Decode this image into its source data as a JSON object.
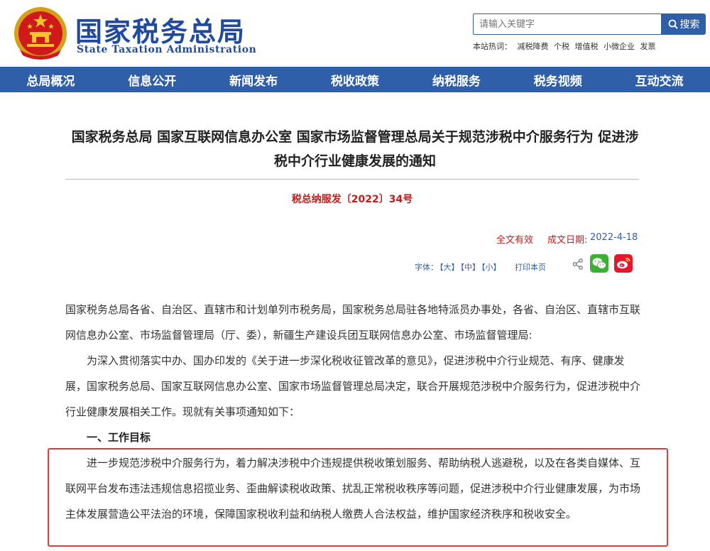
{
  "header": {
    "title_cn": "国家税务总局",
    "title_en": "State Taxation Administration",
    "search_placeholder": "请输入关键字",
    "search_button": "搜索",
    "hotwords_label": "本站热词：",
    "hotwords": [
      "减税降费",
      "个税",
      "增值税",
      "小微企业",
      "发票"
    ]
  },
  "nav": {
    "items": [
      "总局概况",
      "信息公开",
      "新闻发布",
      "税收政策",
      "纳税服务",
      "税务视频",
      "互动交流"
    ]
  },
  "article": {
    "title": "国家税务总局 国家互联网信息办公室 国家市场监督管理总局关于规范涉税中介服务行为 促进涉税中介行业健康发展的通知",
    "doc_number": "税总纳服发〔2022〕34号",
    "status": "全文有效",
    "pubdate_label": "成文日期:",
    "pubdate_value": "2022-4-18",
    "font_label": "字体：",
    "font_large": "【大】",
    "font_medium": "【中】",
    "font_small": "【小】",
    "print": "打印本页",
    "para1": "国家税务总局各省、自治区、直辖市和计划单列市税务局，国家税务总局驻各地特派员办事处，各省、自治区、直辖市互联网信息办公室、市场监督管理局（厅、委），新疆生产建设兵团互联网信息办公室、市场监督管理局:",
    "para2": "为深入贯彻落实中办、国办印发的《关于进一步深化税收征管改革的意见》，促进涉税中介行业规范、有序、健康发展，国家税务总局、国家互联网信息办公室、国家市场监督管理总局决定，联合开展规范涉税中介服务行为，促进涉税中介行业健康发展相关工作。现就有关事项通知如下：",
    "section1": "一、工作目标",
    "para3": "进一步规范涉税中介服务行为，着力解决涉税中介违规提供税收策划服务、帮助纳税人逃避税，以及在各类自媒体、互联网平台发布违法违规信息招揽业务、歪曲解读税收政策、扰乱正常税收秩序等问题，促进涉税中介行业健康发展，为市场主体发展营造公平法治的环境，保障国家税收利益和纳税人缴费人合法权益，维护国家经济秩序和税收安全。"
  },
  "colors": {
    "brand_blue": "#2f5fa8",
    "title_blue": "#1f4aa0",
    "accent_red": "#c81a1a",
    "highlight_red": "#e03a3a",
    "wechat_green": "#3cb034",
    "weibo_red": "#e6162d"
  },
  "icons": {
    "emblem": "national-emblem-icon",
    "search": "search-icon",
    "share": "share-icon",
    "wechat": "wechat-icon",
    "weibo": "weibo-icon"
  }
}
